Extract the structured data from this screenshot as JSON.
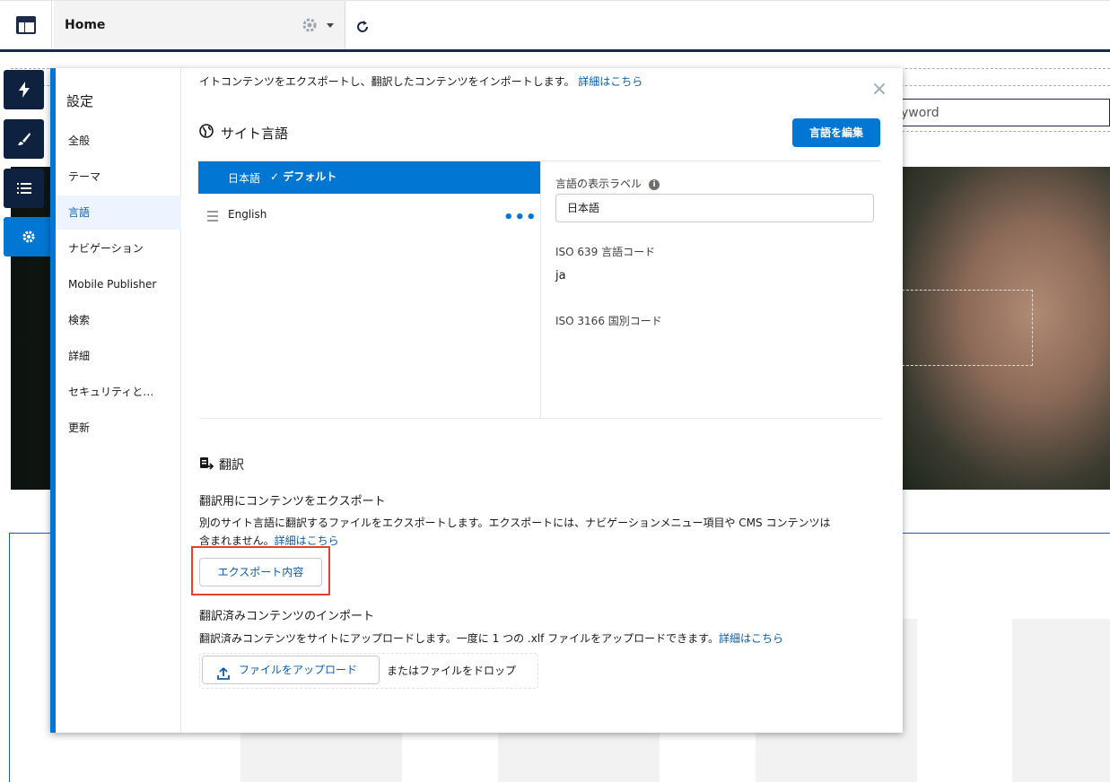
{
  "topbar": {
    "home_label": "Home"
  },
  "background": {
    "search_placeholder_visible": "yword"
  },
  "rail": {
    "items": [
      "lightning-icon",
      "brush-icon",
      "list-icon",
      "gear-icon"
    ]
  },
  "settings": {
    "title": "設定",
    "nav": [
      "全般",
      "テーマ",
      "言語",
      "ナビゲーション",
      "Mobile Publisher",
      "検索",
      "詳細",
      "セキュリティと…",
      "更新"
    ],
    "active_nav": "言語"
  },
  "intro": {
    "text": "イトコンテンツをエクスポートし、翻訳したコンテンツをインポートします。",
    "link": "詳細はこちら"
  },
  "site_language": {
    "title": "サイト言語",
    "edit_button": "言語を編集",
    "languages": [
      {
        "label": "日本語",
        "default_label": "✓ デフォルト",
        "selected": true
      },
      {
        "label": "English",
        "selected": false
      }
    ],
    "detail": {
      "display_label_title": "言語の表示ラベル",
      "display_label_value": "日本語",
      "iso639_title": "ISO 639 言語コード",
      "iso639_value": "ja",
      "iso3166_title": "ISO 3166 国別コード"
    }
  },
  "translation": {
    "title": "翻訳",
    "export_title": "翻訳用にコンテンツをエクスポート",
    "export_desc_line1": "別のサイト言語に翻訳するファイルをエクスポートします。エクスポートには、ナビゲーションメニュー項目や CMS コンテンツは",
    "export_desc_line2": "含まれません。",
    "export_link": "詳細はこちら",
    "export_button": "エクスポート内容",
    "import_title": "翻訳済みコンテンツのインポート",
    "import_desc": "翻訳済みコンテンツをサイトにアップロードします。一度に 1 つの .xlf ファイルをアップロードできます。",
    "import_link": "詳細はこちら",
    "upload_button": "ファイルをアップロード",
    "drop_text": "またはファイルをドロップ"
  },
  "colors": {
    "brand": "#0176d3",
    "rail": "#0e2240",
    "highlight": "#e8402a",
    "link": "#0b5cab"
  }
}
